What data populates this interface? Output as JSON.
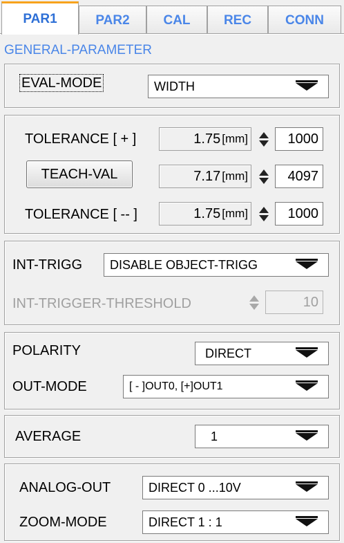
{
  "tabs": [
    {
      "label": "PAR1",
      "active": true
    },
    {
      "label": "PAR2",
      "active": false
    },
    {
      "label": "CAL",
      "active": false
    },
    {
      "label": "REC",
      "active": false
    },
    {
      "label": "CONN",
      "active": false
    }
  ],
  "section_title": "GENERAL-PARAMETER",
  "eval": {
    "label": "EVAL-MODE",
    "value": "WIDTH"
  },
  "tolerance": {
    "plus": {
      "label": "TOLERANCE [ + ]",
      "value": "1.75",
      "unit": "[mm]",
      "raw": "1000"
    },
    "teach": {
      "button": "TEACH-VAL",
      "value": "7.17",
      "unit": "[mm]",
      "raw": "4097"
    },
    "minus": {
      "label": "TOLERANCE [ -- ]",
      "value": "1.75",
      "unit": "[mm]",
      "raw": "1000"
    }
  },
  "trigger": {
    "label": "INT-TRIGG",
    "value": "DISABLE OBJECT-TRIGG",
    "threshold_label": "INT-TRIGGER-THRESHOLD",
    "threshold_value": "10"
  },
  "output": {
    "polarity_label": "POLARITY",
    "polarity_value": "DIRECT",
    "outmode_label": "OUT-MODE",
    "outmode_value": "[ - ]OUT0, [+]OUT1"
  },
  "average": {
    "label": "AVERAGE",
    "value": "1"
  },
  "analog": {
    "analog_label": "ANALOG-OUT",
    "analog_value": "DIRECT 0 ...10V",
    "zoom_label": "ZOOM-MODE",
    "zoom_value": "DIRECT 1 : 1"
  },
  "icons": {
    "dropdown": "chevron-down-icon",
    "spinner": "spinner-arrows-icon"
  },
  "colors": {
    "tab_text": "#4a86e8",
    "active_tab_accent": "#f7a21b",
    "background": "#f0f0f0"
  }
}
